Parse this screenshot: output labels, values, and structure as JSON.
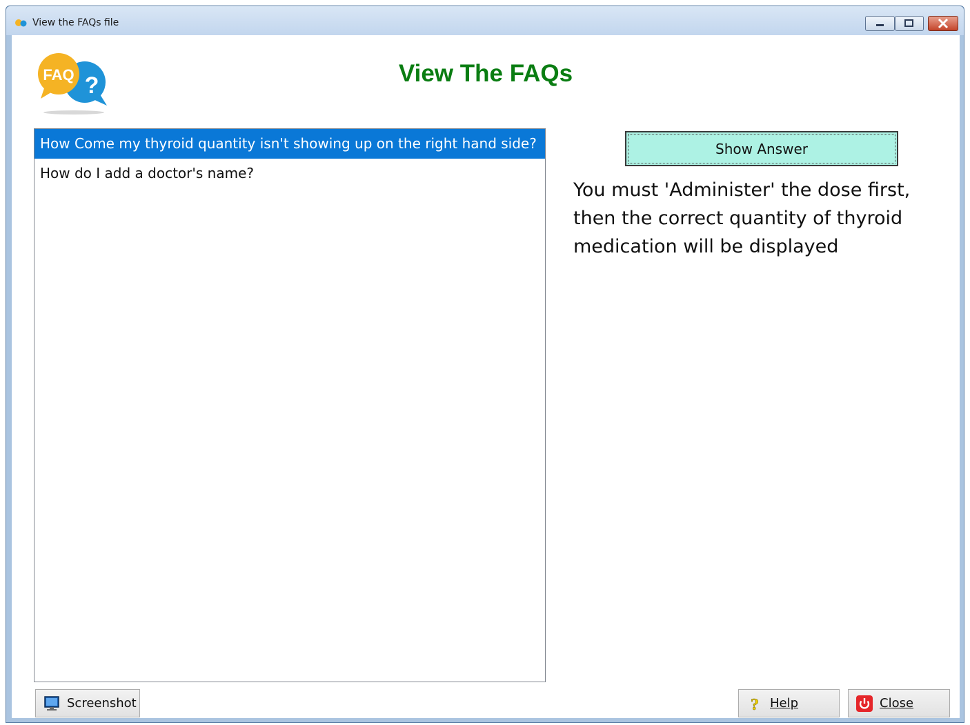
{
  "window": {
    "title": "View the FAQs file"
  },
  "header": {
    "logo_text": "FAQ",
    "logo_mark": "?",
    "title": "View The FAQs"
  },
  "faq_list": {
    "items": [
      {
        "label": "How Come my thyroid quantity isn't showing up on the right hand side?",
        "selected": true
      },
      {
        "label": "How do I add a doctor's name?",
        "selected": false
      }
    ]
  },
  "show_answer_button": {
    "label": "Show Answer"
  },
  "answer": {
    "text": "You must 'Administer' the dose first, then the correct quantity of thyroid medication will be displayed"
  },
  "footer": {
    "screenshot_label": "Screenshot",
    "help_label": "Help",
    "close_label": "Close"
  },
  "icons": {
    "app": "faq-icon",
    "screenshot": "monitor-icon",
    "help": "question-mark-icon",
    "close": "power-icon"
  },
  "colors": {
    "title": "#0a7d12",
    "selection": "#0a78d7",
    "show_answer_bg": "#adf2e4",
    "close_icon": "#e5262a"
  }
}
